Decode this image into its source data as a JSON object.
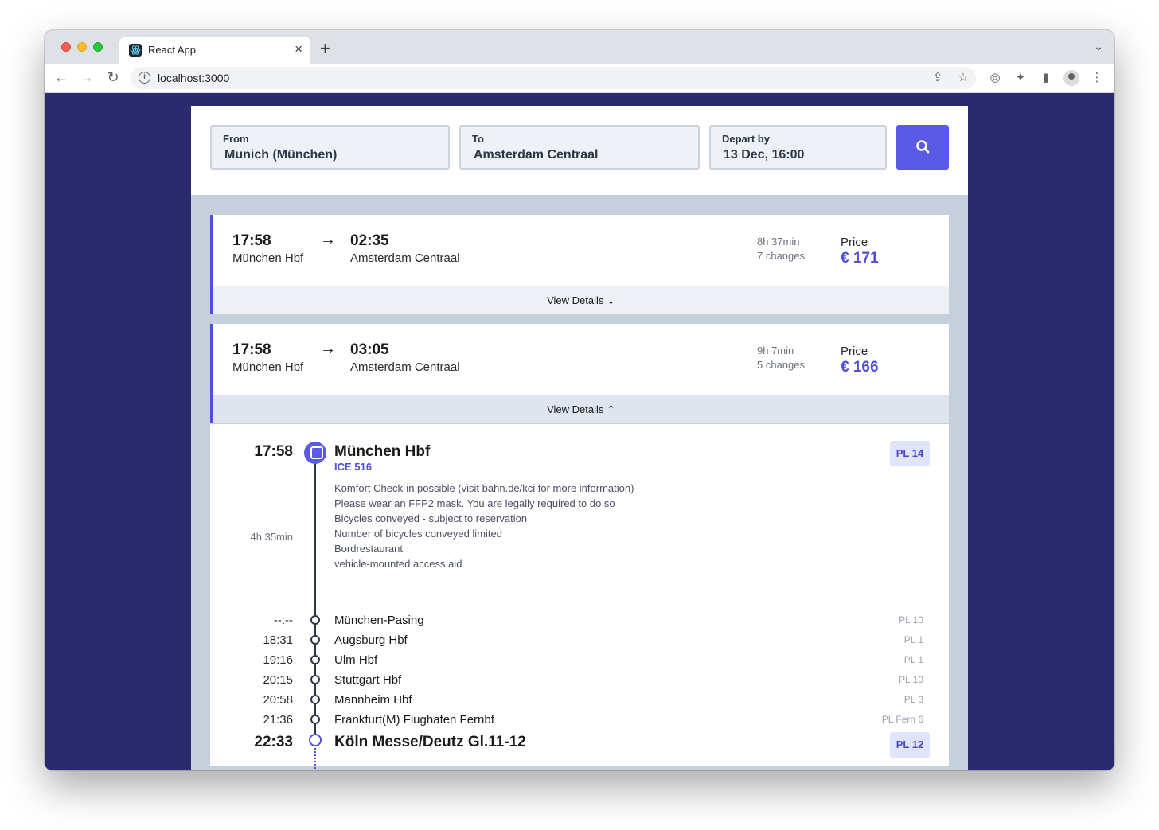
{
  "browser": {
    "tab_title": "React App",
    "url": "localhost:3000"
  },
  "search": {
    "from_label": "From",
    "from_value": "Munich (München)",
    "to_label": "To",
    "to_value": "Amsterdam Centraal",
    "depart_label": "Depart by",
    "depart_value": "13 Dec, 16:00"
  },
  "results": [
    {
      "dep_time": "17:58",
      "dep_station": "München Hbf",
      "arr_time": "02:35",
      "arr_station": "Amsterdam Centraal",
      "duration": "8h 37min",
      "changes": "7 changes",
      "price_label": "Price",
      "price": "€ 171",
      "details_label": "View Details ⌄"
    },
    {
      "dep_time": "17:58",
      "dep_station": "München Hbf",
      "arr_time": "03:05",
      "arr_station": "Amsterdam Centraal",
      "duration": "9h 7min",
      "changes": "5 changes",
      "price_label": "Price",
      "price": "€ 166",
      "details_label": "View Details ⌃"
    }
  ],
  "detail": {
    "start_time": "17:58",
    "start_station": "München Hbf",
    "start_platform": "PL 14",
    "train": "ICE 516",
    "leg_duration": "4h 35min",
    "notes": [
      "Komfort Check-in possible (visit bahn.de/kci for more information)",
      "Please wear an FFP2 mask. You are legally required to do so",
      "Bicycles conveyed - subject to reservation",
      "Number of bicycles conveyed limited",
      "Bordrestaurant",
      "vehicle-mounted access aid"
    ],
    "stops": [
      {
        "time": "--:--",
        "station": "München-Pasing",
        "platform": "PL 10"
      },
      {
        "time": "18:31",
        "station": "Augsburg Hbf",
        "platform": "PL 1"
      },
      {
        "time": "19:16",
        "station": "Ulm Hbf",
        "platform": "PL 1"
      },
      {
        "time": "20:15",
        "station": "Stuttgart Hbf",
        "platform": "PL 10"
      },
      {
        "time": "20:58",
        "station": "Mannheim Hbf",
        "platform": "PL 3"
      },
      {
        "time": "21:36",
        "station": "Frankfurt(M) Flughafen Fernbf",
        "platform": "PL Fern 6"
      }
    ],
    "end_time": "22:33",
    "end_station": "Köln Messe/Deutz Gl.11-12",
    "end_platform": "PL 12"
  }
}
